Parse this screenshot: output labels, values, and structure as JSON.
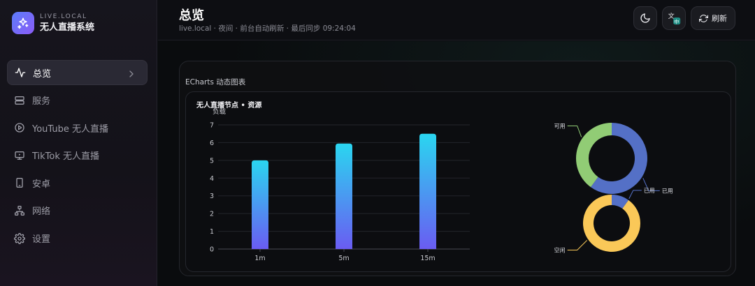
{
  "brand": {
    "sub": "LIVE.LOCAL",
    "title": "无人直播系统",
    "logo_icon": "sparkle-icon"
  },
  "nav": [
    {
      "label": "总览",
      "icon": "activity-icon",
      "active": true
    },
    {
      "label": "服务",
      "icon": "server-icon",
      "active": false
    },
    {
      "label": "YouTube 无人直播",
      "icon": "play-circle-icon",
      "active": false
    },
    {
      "label": "TikTok 无人直播",
      "icon": "monitor-icon",
      "active": false
    },
    {
      "label": "安卓",
      "icon": "smartphone-icon",
      "active": false
    },
    {
      "label": "网络",
      "icon": "network-icon",
      "active": false
    },
    {
      "label": "设置",
      "icon": "gear-icon",
      "active": false
    }
  ],
  "header": {
    "title": "总览",
    "subtitle": "live.local · 夜间 · 前台自动刷新 · 最后同步 09:24:04",
    "theme_icon": "moon-icon",
    "lang_icon": "translate-icon",
    "refresh_label": "刷新"
  },
  "card": {
    "title": "ECharts 动态图表"
  },
  "colors": {
    "bar_top": "#2ad6f0",
    "bar_bottom": "#6a5cf2",
    "used": "#5470c6",
    "free": "#91cc75",
    "idle": "#fac858"
  },
  "chart_data": [
    {
      "type": "bar",
      "title": "无人直播节点 • 资源",
      "ylabel": "负载",
      "categories": [
        "1m",
        "5m",
        "15m"
      ],
      "values": [
        5.0,
        5.95,
        6.5
      ],
      "ylim": [
        0,
        7
      ],
      "yticks": [
        0,
        1,
        2,
        3,
        4,
        5,
        6,
        7
      ],
      "grid": true
    },
    {
      "type": "pie",
      "style": "donut",
      "slices": [
        {
          "label": "已用",
          "value": 60
        },
        {
          "label": "可用",
          "value": 40
        }
      ]
    },
    {
      "type": "pie",
      "style": "donut",
      "slices": [
        {
          "label": "已用",
          "value": 10
        },
        {
          "label": "空闲",
          "value": 90
        }
      ]
    }
  ]
}
